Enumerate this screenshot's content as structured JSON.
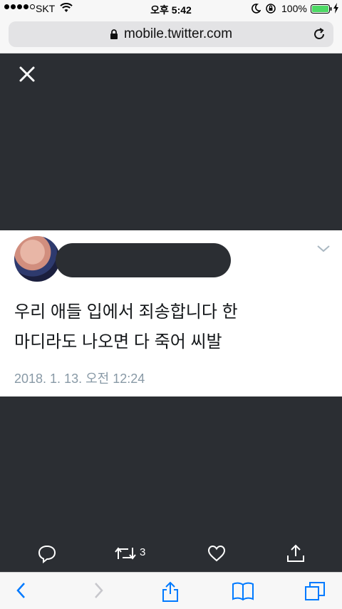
{
  "status_bar": {
    "carrier": "SKT",
    "time": "오후 5:42",
    "battery": "100%"
  },
  "browser": {
    "url": "mobile.twitter.com"
  },
  "tweet": {
    "text_line1": "우리 애들 입에서 죄송합니다 한",
    "text_line2": "마디라도 나오면 다 죽어 씨발",
    "timestamp": "2018. 1. 13. 오전 12:24"
  },
  "actions": {
    "retweet_count": "3"
  },
  "colors": {
    "media_background": "#2b2e33",
    "safari_blue": "#007aff",
    "timestamp_gray": "#8899a6"
  }
}
